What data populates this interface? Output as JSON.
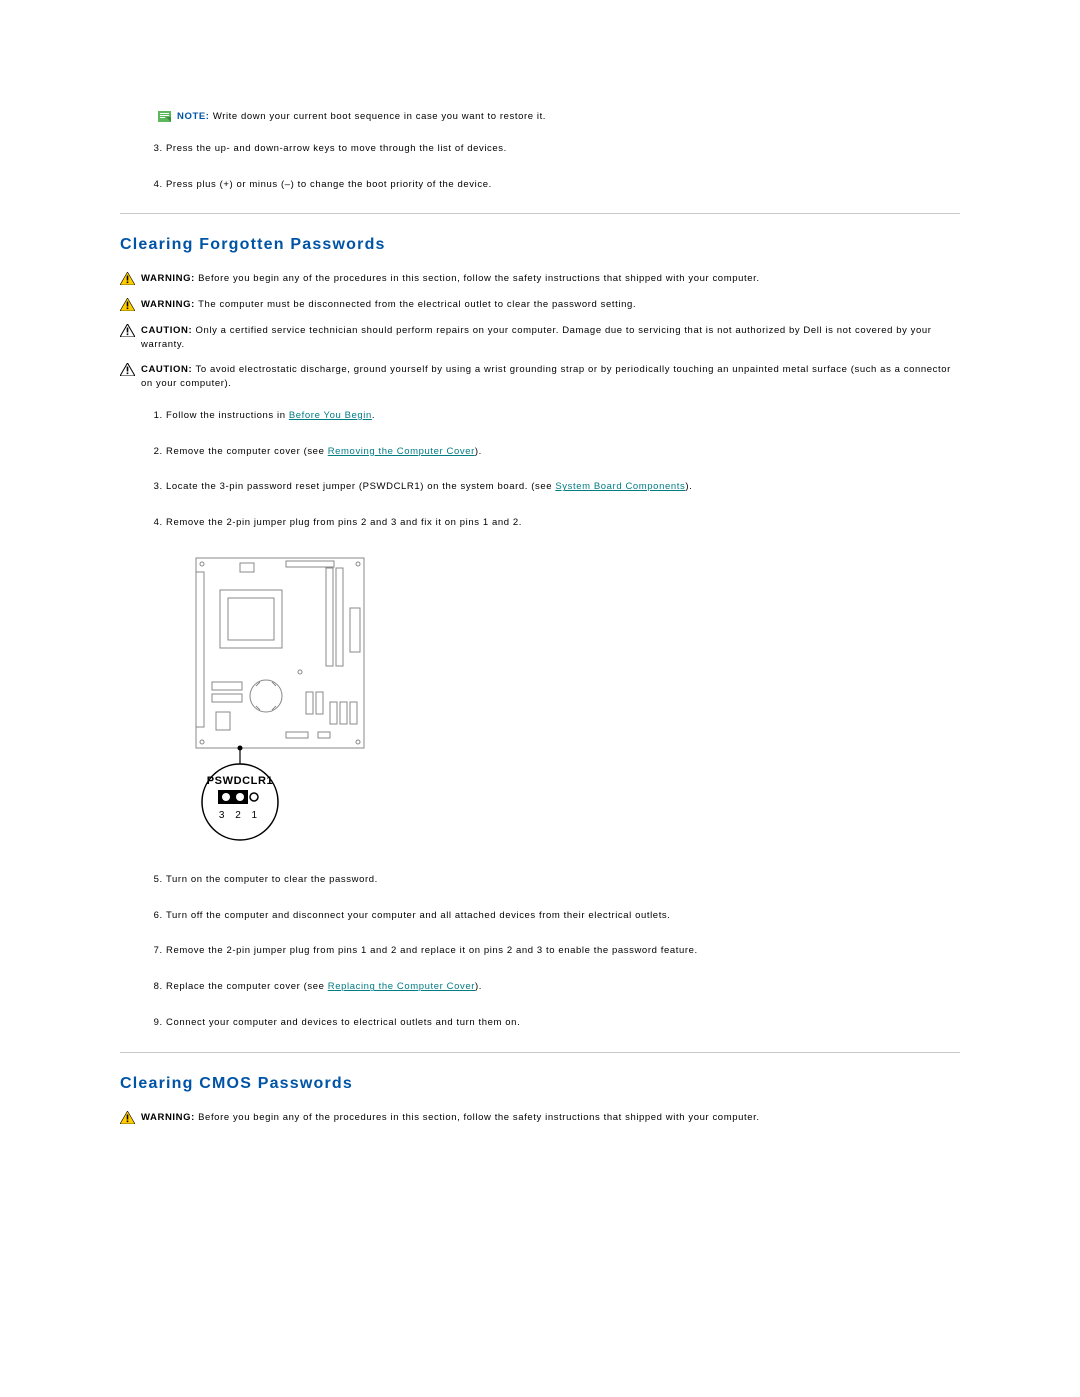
{
  "note": {
    "label": "NOTE:",
    "text": "Write down your current boot sequence in case you want to restore it."
  },
  "topSteps": {
    "start": 3,
    "items": [
      "Press the up- and down-arrow keys to move through the list of devices.",
      "Press plus (+) or minus (–) to change the boot priority of the device."
    ]
  },
  "section1": {
    "title": "Clearing Forgotten Passwords",
    "admonitions": [
      {
        "kind": "warning",
        "label": "WARNING:",
        "text": "Before you begin any of the procedures in this section, follow the safety instructions that shipped with your computer."
      },
      {
        "kind": "warning",
        "label": "WARNING:",
        "text": "The computer must be disconnected from the electrical outlet to clear the password setting."
      },
      {
        "kind": "caution",
        "label": "CAUTION:",
        "text": "Only a certified service technician should perform repairs on your computer. Damage due to servicing that is not authorized by Dell is not covered by your warranty."
      },
      {
        "kind": "caution",
        "label": "CAUTION:",
        "text": "To avoid electrostatic discharge, ground yourself by using a wrist grounding strap or by periodically touching an unpainted metal surface (such as a connector on your computer)."
      }
    ],
    "stepsA": {
      "items": [
        {
          "pre": "Follow the instructions in ",
          "link": "Before You Begin",
          "post": "."
        },
        {
          "pre": "Remove the computer cover (see ",
          "link": "Removing the Computer Cover",
          "post": ")."
        },
        {
          "pre": "Locate the 3-pin password reset jumper (PSWDCLR1) on the system board. (see ",
          "link": "System Board Components",
          "post": ")."
        },
        {
          "pre": "Remove the 2-pin jumper plug from pins 2 and 3 and fix it on pins 1 and 2.",
          "link": "",
          "post": ""
        }
      ]
    },
    "figure": {
      "label": "PSWDCLR1",
      "pins": "3 2 1"
    },
    "stepsB": {
      "start": 5,
      "items": [
        {
          "pre": "Turn on the computer to clear the password.",
          "link": "",
          "post": ""
        },
        {
          "pre": "Turn off the computer and disconnect your computer and all attached devices from their electrical outlets.",
          "link": "",
          "post": ""
        },
        {
          "pre": "Remove the 2-pin jumper plug from pins 1 and 2 and replace it on pins 2 and 3 to enable the password feature.",
          "link": "",
          "post": ""
        },
        {
          "pre": "Replace the computer cover (see ",
          "link": "Replacing the Computer Cover",
          "post": ")."
        },
        {
          "pre": "Connect your computer and devices to electrical outlets and turn them on.",
          "link": "",
          "post": ""
        }
      ]
    }
  },
  "section2": {
    "title": "Clearing CMOS Passwords",
    "admonitions": [
      {
        "kind": "warning",
        "label": "WARNING:",
        "text": "Before you begin any of the procedures in this section, follow the safety instructions that shipped with your computer."
      }
    ]
  }
}
